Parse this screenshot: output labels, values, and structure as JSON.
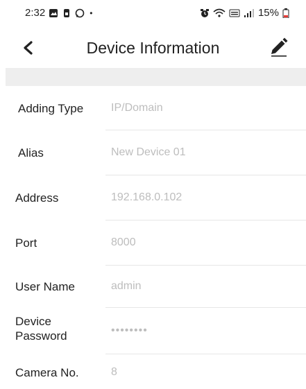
{
  "status_bar": {
    "time": "2:32",
    "battery": "15%",
    "dot": "•"
  },
  "header": {
    "title": "Device Information"
  },
  "fields": {
    "adding_type": {
      "label": "Adding Type",
      "value": "IP/Domain"
    },
    "alias": {
      "label": "Alias",
      "value": "New Device 01"
    },
    "address": {
      "label": "Address",
      "value": "192.168.0.102"
    },
    "port": {
      "label": "Port",
      "value": "8000"
    },
    "user_name": {
      "label": "User Name",
      "value": "admin"
    },
    "device_password": {
      "label_line1": "Device",
      "label_line2": "Password",
      "value": "••••••••"
    },
    "camera_no": {
      "label": "Camera No.",
      "value": "8"
    }
  },
  "colors": {
    "text": "#222222",
    "value_text": "#bdbdbd",
    "section_gap": "#eeeeee",
    "divider": "#e6e6e6"
  },
  "icons": {
    "back": "chevron-left-icon",
    "edit": "pencil-icon"
  }
}
